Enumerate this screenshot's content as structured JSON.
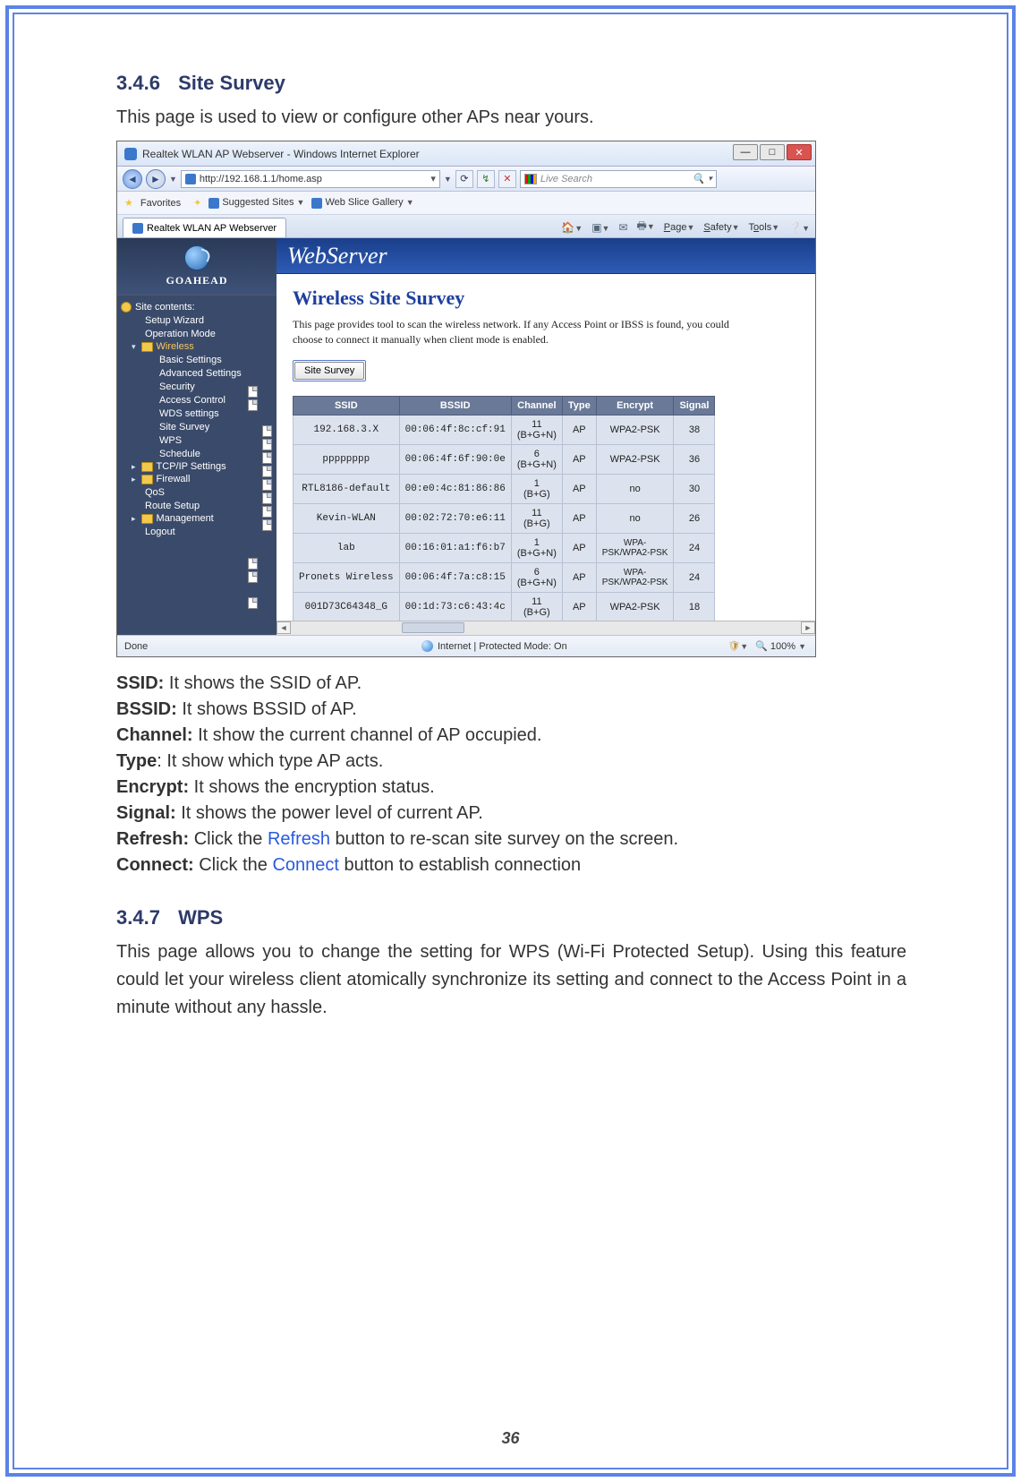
{
  "section1": {
    "number": "3.4.6",
    "title": "Site Survey"
  },
  "intro1": "This page is used to view or configure other APs near yours.",
  "section2": {
    "number": "3.4.7",
    "title": "WPS"
  },
  "intro2": "This page allows you to change the setting for WPS (Wi-Fi Protected Setup). Using this feature could let your wireless client atomically synchronize its setting and connect to the Access Point in a minute without any hassle.",
  "definitions": [
    {
      "term": "SSID:",
      "text": " It shows the SSID of AP."
    },
    {
      "term": "BSSID:",
      "text": " It shows BSSID of AP."
    },
    {
      "term": "Channel:",
      "text": " It show the current channel of AP occupied."
    },
    {
      "term": "Type",
      "text": ": It show which type AP acts."
    },
    {
      "term": "Encrypt:",
      "text": " It shows the encryption status."
    },
    {
      "term": "Signal:",
      "text": " It shows the power level of current AP."
    },
    {
      "term": "Refresh:",
      "text_before": " Click the ",
      "link": "Refresh",
      "text_after": " button to re-scan site survey on the screen."
    },
    {
      "term": "Connect:",
      "text_before": " Click the ",
      "link": "Connect",
      "text_after": " button to establish connection"
    }
  ],
  "page_number": "36",
  "browser": {
    "window_title": "Realtek WLAN AP Webserver - Windows Internet Explorer",
    "url": "http://192.168.1.1/home.asp",
    "search_placeholder": "Live Search",
    "favorites_label": "Favorites",
    "suggested_sites": "Suggested Sites",
    "web_slice": "Web Slice Gallery",
    "tab_title": "Realtek WLAN AP Webserver",
    "cmd_page": "Page",
    "cmd_safety": "Safety",
    "cmd_tools": "Tools",
    "status_left": "Done",
    "status_mid": "Internet | Protected Mode: On",
    "zoom": "100%"
  },
  "sidebar": {
    "brand": "GOAHEAD",
    "header": "Site contents:",
    "items": [
      {
        "label": "Setup Wizard",
        "icon": "page",
        "ind": 1
      },
      {
        "label": "Operation Mode",
        "icon": "page",
        "ind": 1
      },
      {
        "label": "Wireless",
        "icon": "folder",
        "ind": 1,
        "active": true,
        "orange": true
      },
      {
        "label": "Basic Settings",
        "icon": "page",
        "ind": 2
      },
      {
        "label": "Advanced Settings",
        "icon": "page",
        "ind": 2
      },
      {
        "label": "Security",
        "icon": "page",
        "ind": 2
      },
      {
        "label": "Access Control",
        "icon": "page",
        "ind": 2
      },
      {
        "label": "WDS settings",
        "icon": "page",
        "ind": 2
      },
      {
        "label": "Site Survey",
        "icon": "page",
        "ind": 2
      },
      {
        "label": "WPS",
        "icon": "page",
        "ind": 2
      },
      {
        "label": "Schedule",
        "icon": "page",
        "ind": 2
      },
      {
        "label": "TCP/IP Settings",
        "icon": "folder",
        "ind": 1
      },
      {
        "label": "Firewall",
        "icon": "folder",
        "ind": 1
      },
      {
        "label": "QoS",
        "icon": "page",
        "ind": 1
      },
      {
        "label": "Route Setup",
        "icon": "page",
        "ind": 1
      },
      {
        "label": "Management",
        "icon": "folder",
        "ind": 1
      },
      {
        "label": "Logout",
        "icon": "page",
        "ind": 1
      }
    ]
  },
  "webserver": {
    "banner": "WebServer",
    "heading": "Wireless Site Survey",
    "desc": "This page provides tool to scan the wireless network. If any Access Point or IBSS is found, you could choose to connect it manually when client mode is enabled.",
    "button": "Site Survey",
    "columns": [
      "SSID",
      "BSSID",
      "Channel",
      "Type",
      "Encrypt",
      "Signal"
    ],
    "rows": [
      {
        "ssid": "192.168.3.X",
        "bssid": "00:06:4f:8c:cf:91",
        "channel": "11 (B+G+N)",
        "type": "AP",
        "encrypt": "WPA2-PSK",
        "signal": "38"
      },
      {
        "ssid": "pppppppp",
        "bssid": "00:06:4f:6f:90:0e",
        "channel": "6 (B+G+N)",
        "type": "AP",
        "encrypt": "WPA2-PSK",
        "signal": "36"
      },
      {
        "ssid": "RTL8186-default",
        "bssid": "00:e0:4c:81:86:86",
        "channel": "1 (B+G)",
        "type": "AP",
        "encrypt": "no",
        "signal": "30"
      },
      {
        "ssid": "Kevin-WLAN",
        "bssid": "00:02:72:70:e6:11",
        "channel": "11 (B+G)",
        "type": "AP",
        "encrypt": "no",
        "signal": "26"
      },
      {
        "ssid": "lab",
        "bssid": "00:16:01:a1:f6:b7",
        "channel": "1 (B+G+N)",
        "type": "AP",
        "encrypt": "WPA-PSK/WPA2-PSK",
        "signal": "24"
      },
      {
        "ssid": "Pronets Wireless",
        "bssid": "00:06:4f:7a:c8:15",
        "channel": "6 (B+G+N)",
        "type": "AP",
        "encrypt": "WPA-PSK/WPA2-PSK",
        "signal": "24"
      },
      {
        "ssid": "001D73C64348_G",
        "bssid": "00:1d:73:c6:43:4c",
        "channel": "11 (B+G)",
        "type": "AP",
        "encrypt": "WPA2-PSK",
        "signal": "18"
      }
    ]
  }
}
